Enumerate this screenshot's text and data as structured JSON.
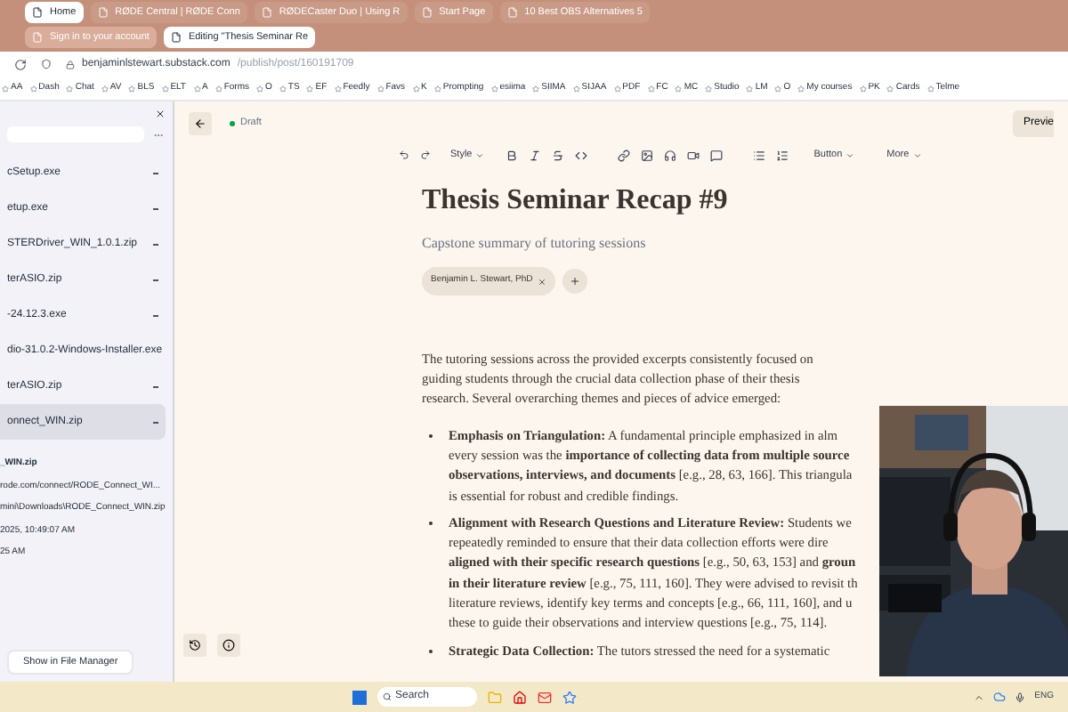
{
  "tabs_row_1": [
    {
      "label": "Home",
      "selected": true
    },
    {
      "label": "RØDE Central | RØDE Conn",
      "selected": false
    },
    {
      "label": "RØDECaster Duo | Using R",
      "selected": false
    },
    {
      "label": "Start Page",
      "selected": false
    },
    {
      "label": "10 Best OBS Alternatives 5",
      "selected": false
    }
  ],
  "tabs_row_2": [
    {
      "label": "Sign in to your account",
      "selected": false
    },
    {
      "label": "Editing \"Thesis Seminar Re",
      "selected": true
    }
  ],
  "address_bar": {
    "host": "benjaminlstewart.substack.com",
    "path": "/publish/post/160191709"
  },
  "bookmarks": [
    "AA",
    "Dash",
    "Chat",
    "AV",
    "BLS",
    "ELT",
    "A",
    "Forms",
    "O",
    "TS",
    "EF",
    "Feedly",
    "Favs",
    "K",
    "Prompting",
    "esiima",
    "SIIMA",
    "SIJAA",
    "PDF",
    "FC",
    "MC",
    "Studio",
    "LM",
    "O",
    "My courses",
    "PK",
    "Cards",
    "Telme"
  ],
  "downloads": {
    "items": [
      {
        "name": "cSetup.exe",
        "selected": false
      },
      {
        "name": "etup.exe",
        "selected": false
      },
      {
        "name": "STERDriver_WIN_1.0.1.zip",
        "selected": false
      },
      {
        "name": "terASIO.zip",
        "selected": false
      },
      {
        "name": "-24.12.3.exe",
        "selected": false
      },
      {
        "name": "dio-31.0.2-Windows-Installer.exe",
        "selected": false
      },
      {
        "name": "terASIO.zip",
        "selected": false
      },
      {
        "name": "onnect_WIN.zip",
        "selected": true
      }
    ],
    "details": {
      "name": "_WIN.zip",
      "url": "rode.com/connect/RODE_Connect_WI...",
      "path": "mini\\Downloads\\RODE_Connect_WIN.zip",
      "started": "2025, 10:49:07 AM",
      "finished": "25 AM"
    },
    "button": "Show in File Manager"
  },
  "editor": {
    "status": "Draft",
    "preview_button": "Previe",
    "toolbar": {
      "style": "Style",
      "button": "Button",
      "more": "More"
    },
    "title": "Thesis Seminar Recap #9",
    "subtitle": "Capstone summary of tutoring sessions",
    "author": "Benjamin L. Stewart, PhD",
    "intro_lines": [
      "The tutoring sessions across the provided excerpts consistently focused on",
      "guiding students through the crucial data collection phase of their thesis",
      "research. Several overarching themes and pieces of advice emerged:"
    ],
    "bullets": [
      {
        "lines": [
          "**Emphasis on Triangulation:** A fundamental principle emphasized in alm",
          "every session was the **importance of collecting data from multiple source**",
          "**observations, interviews, and documents** [e.g., 28, 63, 166]. This triangula",
          "is essential for robust and credible findings."
        ]
      },
      {
        "lines": [
          "**Alignment with Research Questions and Literature Review:** Students we",
          "repeatedly reminded to ensure that their data collection efforts were dire",
          "**aligned with their specific research questions** [e.g., 50, 63, 153] and **groun**",
          "**in their literature review** [e.g., 75, 111, 160]. They were advised to revisit th",
          "literature reviews, identify key terms and concepts [e.g., 66, 111, 160], and u",
          "these to guide their observations and interview questions [e.g., 75, 114]."
        ]
      },
      {
        "lines": [
          "**Strategic Data Collection:** The tutors stressed the need for a systematic"
        ]
      }
    ]
  },
  "taskbar": {
    "search_placeholder": "Search",
    "language": "ENG"
  }
}
